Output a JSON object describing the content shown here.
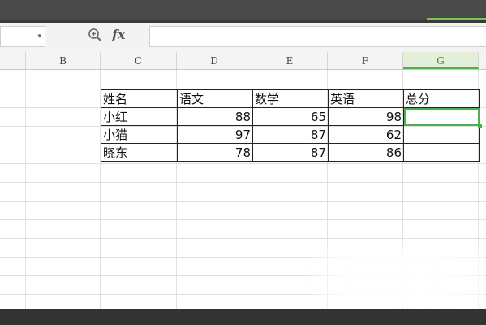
{
  "formula_bar": {
    "name_box_value": "",
    "dropdown_glyph": "▾",
    "zoom_icon": "zoom-icon",
    "fx_label": "fx",
    "formula_value": ""
  },
  "columns": [
    {
      "label": "B",
      "active": false
    },
    {
      "label": "C",
      "active": false
    },
    {
      "label": "D",
      "active": false
    },
    {
      "label": "E",
      "active": false
    },
    {
      "label": "F",
      "active": false
    },
    {
      "label": "G",
      "active": true
    }
  ],
  "table": {
    "headers": [
      "姓名",
      "语文",
      "数学",
      "英语",
      "总分"
    ],
    "rows": [
      {
        "name": "小红",
        "yuwen": "88",
        "shuxue": "65",
        "yingyu": "98",
        "zongfen": ""
      },
      {
        "name": "小猫",
        "yuwen": "97",
        "shuxue": "87",
        "yingyu": "62",
        "zongfen": ""
      },
      {
        "name": "晓东",
        "yuwen": "78",
        "shuxue": "87",
        "yingyu": "86",
        "zongfen": ""
      }
    ]
  },
  "colors": {
    "accent": "#4caf50",
    "header_bg": "#f4f4f4",
    "grid": "#e0e0e0"
  }
}
